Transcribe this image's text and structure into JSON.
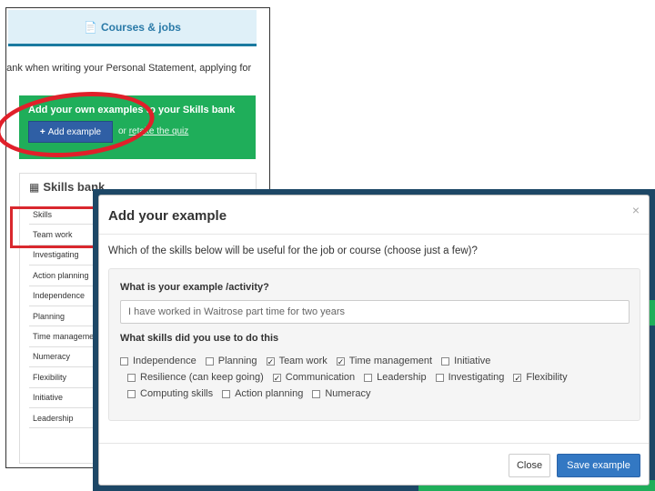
{
  "background": {
    "header_title": "Courses & jobs",
    "statement_text": "bank when writing your Personal Statement, applying for",
    "green_box": {
      "title": "Add your own examples to your Skills bank",
      "add_button_label": "Add example",
      "or_text": "or",
      "retake_link": "retake the quiz"
    },
    "skills_bank": {
      "title": "Skills bank",
      "rows": [
        "Skills",
        "Team work",
        "Investigating",
        "Action planning",
        "Independence",
        "Planning",
        "Time management",
        "Numeracy",
        "Flexibility",
        "Initiative",
        "Leadership"
      ]
    }
  },
  "modal": {
    "title": "Add your example",
    "close_icon": "×",
    "question": "Which of the skills below will be useful for the job or course (choose just a few)?",
    "example_label": "What is your example /activity?",
    "example_value": "I have worked in Waitrose part time for two years",
    "skills_label": "What skills did you use to do this",
    "skills": [
      {
        "label": "Independence",
        "checked": false
      },
      {
        "label": "Planning",
        "checked": false
      },
      {
        "label": "Team work",
        "checked": true
      },
      {
        "label": "Time management",
        "checked": true
      },
      {
        "label": "Initiative",
        "checked": false
      },
      {
        "label": "Resilience (can keep going)",
        "checked": false
      },
      {
        "label": "Communication",
        "checked": true
      },
      {
        "label": "Leadership",
        "checked": false
      },
      {
        "label": "Investigating",
        "checked": false
      },
      {
        "label": "Flexibility",
        "checked": true
      },
      {
        "label": "Computing skills",
        "checked": false
      },
      {
        "label": "Action planning",
        "checked": false
      },
      {
        "label": "Numeracy",
        "checked": false
      }
    ],
    "close_button": "Close",
    "save_button": "Save example"
  },
  "colors": {
    "green": "#1fae5a",
    "primary_blue": "#3378c3",
    "annotation_red": "#e0202a",
    "backdrop": "#1d4766"
  }
}
